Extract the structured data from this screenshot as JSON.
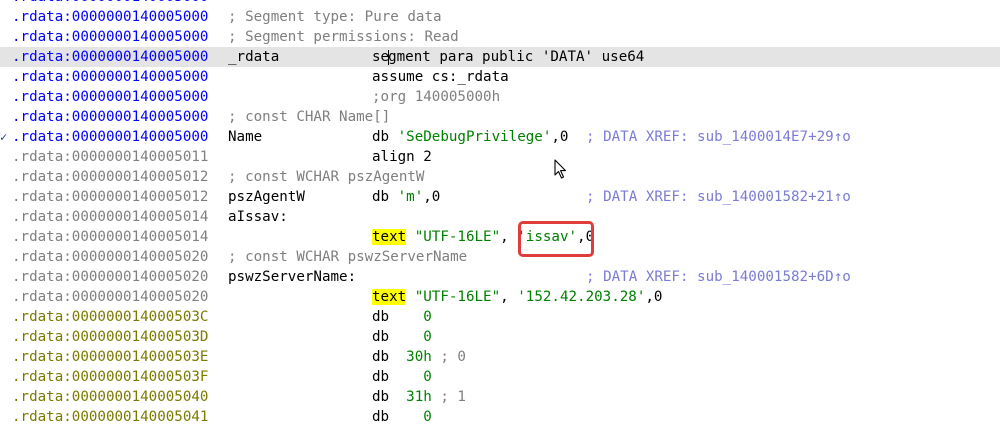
{
  "lines": [
    {
      "addr": ".rdata:0000000140005000",
      "addr_color": "blue",
      "comment": "",
      "label": "",
      "instr": ""
    },
    {
      "addr": ".rdata:0000000140005000",
      "addr_color": "blue",
      "comment": "; Segment type: Pure data"
    },
    {
      "addr": ".rdata:0000000140005000",
      "addr_color": "blue",
      "comment": "; Segment permissions: Read"
    },
    {
      "addr": ".rdata:0000000140005000",
      "addr_color": "blue",
      "label": "_rdata",
      "instr_a": "se",
      "instr_b": "gment para public 'DATA' use64",
      "selected": true
    },
    {
      "addr": ".rdata:0000000140005000",
      "addr_color": "blue",
      "instr": "assume cs:_rdata"
    },
    {
      "addr": ".rdata:0000000140005000",
      "addr_color": "blue",
      "instr_comment": ";org 140005000h"
    },
    {
      "addr": ".rdata:0000000140005000",
      "addr_color": "blue",
      "comment": "; const CHAR Name[]"
    },
    {
      "addr": ".rdata:0000000140005000",
      "addr_color": "blue",
      "label": "Name",
      "db": "db ",
      "str": "'SeDebugPrivilege'",
      "tail": ",0 ",
      "xref": "; DATA XREF: sub_1400014E7+29↑o",
      "arrow": "✓"
    },
    {
      "addr": ".rdata:0000000140005011",
      "addr_color": "gray",
      "instr": "align 2"
    },
    {
      "addr": ".rdata:0000000140005012",
      "addr_color": "gray",
      "comment": "; const WCHAR pszAgentW"
    },
    {
      "addr": ".rdata:0000000140005012",
      "addr_color": "gray",
      "label": "pszAgentW",
      "db": "db ",
      "str": "'m'",
      "tail": ",0",
      "xref": "; DATA XREF: sub_140001582+21↑o"
    },
    {
      "addr": ".rdata:0000000140005014",
      "addr_color": "gray",
      "label": "aIssav:"
    },
    {
      "addr": ".rdata:0000000140005014",
      "addr_color": "gray",
      "kw": "text",
      "s1": "\"UTF-16LE\"",
      "sep": ", ",
      "s2": "'issav'",
      "tail": ",0"
    },
    {
      "addr": ".rdata:0000000140005020",
      "addr_color": "gray",
      "comment": "; const WCHAR pswzServerName"
    },
    {
      "addr": ".rdata:0000000140005020",
      "addr_color": "gray",
      "label": "pswzServerName:",
      "xref": "; DATA XREF: sub_140001582+6D↑o"
    },
    {
      "addr": ".rdata:0000000140005020",
      "addr_color": "gray",
      "kw": "text",
      "s1": "\"UTF-16LE\"",
      "sep": ", ",
      "s2": "'152.42.203.28'",
      "tail": ",0"
    },
    {
      "addr": ".rdata:000000014000503C",
      "addr_color": "olive",
      "db": "db    ",
      "num": "0"
    },
    {
      "addr": ".rdata:000000014000503D",
      "addr_color": "olive",
      "db": "db    ",
      "num": "0"
    },
    {
      "addr": ".rdata:000000014000503E",
      "addr_color": "olive",
      "db": "db  ",
      "num": "30h",
      "ncomment": " ; 0"
    },
    {
      "addr": ".rdata:000000014000503F",
      "addr_color": "olive",
      "db": "db    ",
      "num": "0"
    },
    {
      "addr": ".rdata:0000000140005040",
      "addr_color": "olive",
      "db": "db  ",
      "num": "31h",
      "ncomment": " ; 1"
    },
    {
      "addr": ".rdata:0000000140005041",
      "addr_color": "olive",
      "db": "db    ",
      "num": "0"
    }
  ]
}
